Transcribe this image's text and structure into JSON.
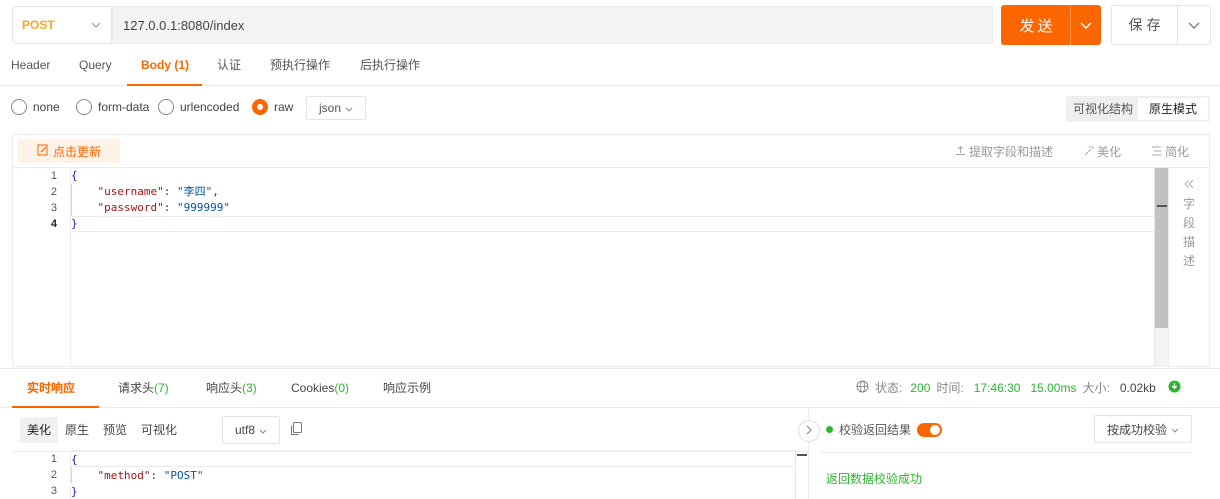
{
  "request": {
    "method": "POST",
    "url": "127.0.0.1:8080/index",
    "send_label": "发送",
    "save_label": "保存"
  },
  "request_tabs": {
    "header": "Header",
    "query": "Query",
    "body": "Body (1)",
    "auth": "认证",
    "pre": "预执行操作",
    "post": "后执行操作"
  },
  "body_types": {
    "none": "none",
    "form_data": "form-data",
    "urlencoded": "urlencoded",
    "raw": "raw",
    "selected": "raw",
    "format": "json"
  },
  "view_modes": {
    "visual": "可视化结构",
    "raw": "原生模式",
    "selected": "原生模式"
  },
  "editor_toolbar": {
    "update": "点击更新",
    "extract": "提取字段和描述",
    "beautify": "美化",
    "simplify": "简化"
  },
  "request_body": {
    "line_numbers": [
      "1",
      "2",
      "3",
      "4"
    ],
    "open_brace": "{",
    "close_brace": "}",
    "username_key": "\"username\"",
    "username_value": "\"李四\"",
    "password_key": "\"password\"",
    "password_value": "\"999999\""
  },
  "side_panel": {
    "chars": [
      "字",
      "段",
      "描",
      "述"
    ]
  },
  "response_tabs": {
    "live": "实时响应",
    "req_headers": "请求头",
    "req_headers_count": "(7)",
    "resp_headers": "响应头",
    "resp_headers_count": "(3)",
    "cookies": "Cookies",
    "cookies_count": "(0)",
    "example": "响应示例"
  },
  "status": {
    "status_label": "状态:",
    "status_code": "200",
    "time_label": "时间:",
    "time_value": "17:46:30",
    "duration": "15.00ms",
    "size_label": "大小:",
    "size_value": "0.02kb"
  },
  "response_toolbar": {
    "beautify": "美化",
    "raw": "原生",
    "preview": "预览",
    "visual": "可视化",
    "encoding": "utf8"
  },
  "response_body": {
    "line_numbers": [
      "1",
      "2",
      "3"
    ],
    "open_brace": "{",
    "close_brace": "}",
    "method_key": "\"method\"",
    "method_value": "\"POST\""
  },
  "validation": {
    "toggle_label": "校验返回结果",
    "mode": "按成功校验",
    "message": "返回数据校验成功"
  },
  "colors": {
    "accent": "#fb6600",
    "success": "#2db52d",
    "method": "#f5a623"
  }
}
